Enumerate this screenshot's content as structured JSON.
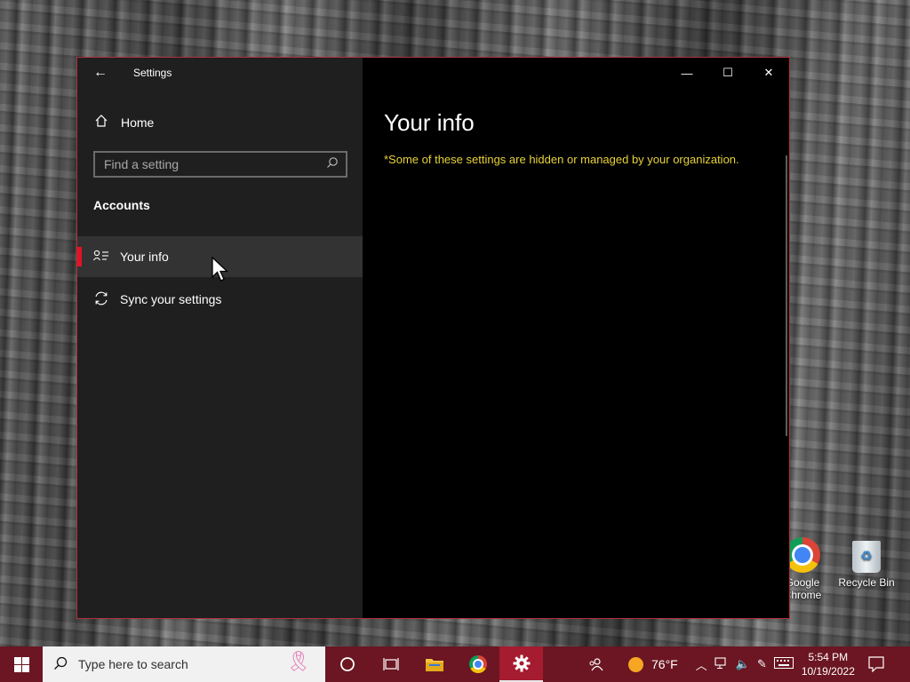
{
  "window": {
    "title": "Settings",
    "minimize_glyph": "—",
    "maximize_glyph": "☐",
    "close_glyph": "✕"
  },
  "sidebar": {
    "home_label": "Home",
    "search_placeholder": "Find a setting",
    "section_heading": "Accounts",
    "items": [
      {
        "label": "Your info",
        "icon": "contact-info-icon",
        "active": true
      },
      {
        "label": "Sync your settings",
        "icon": "sync-icon",
        "active": false
      }
    ]
  },
  "content": {
    "title": "Your info",
    "notice": "*Some of these settings are hidden or managed by your organization."
  },
  "desktop": {
    "icons": [
      {
        "label": "Google Chrome",
        "icon": "chrome-icon"
      },
      {
        "label": "Recycle Bin",
        "icon": "recycle-bin-icon"
      }
    ]
  },
  "taskbar": {
    "search_placeholder": "Type here to search",
    "weather": "76°F",
    "clock_time": "5:54 PM",
    "clock_date": "10/19/2022",
    "accent_color": "#6b1622",
    "active_app": "Settings"
  }
}
